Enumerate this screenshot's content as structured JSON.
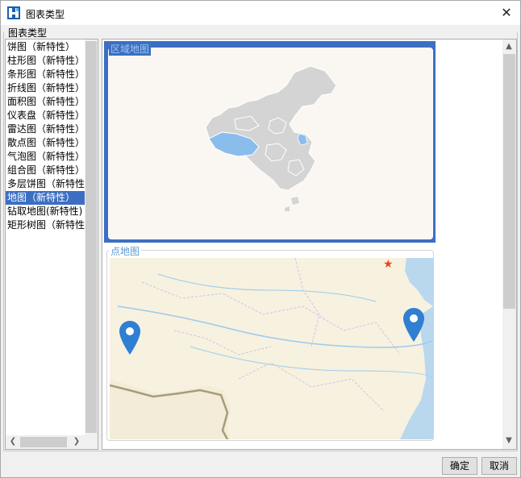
{
  "window": {
    "title": "图表类型"
  },
  "group": {
    "label": "图表类型"
  },
  "list": {
    "items": [
      {
        "label": "饼图（新特性）"
      },
      {
        "label": "柱形图（新特性）"
      },
      {
        "label": "条形图（新特性）"
      },
      {
        "label": "折线图（新特性）"
      },
      {
        "label": "面积图（新特性）"
      },
      {
        "label": "仪表盘（新特性）"
      },
      {
        "label": "雷达图（新特性）"
      },
      {
        "label": "散点图（新特性）"
      },
      {
        "label": "气泡图（新特性）"
      },
      {
        "label": "组合图（新特性）"
      },
      {
        "label": "多层饼图（新特性"
      },
      {
        "label": "地图（新特性）"
      },
      {
        "label": "钻取地图(新特性)"
      },
      {
        "label": "矩形树图（新特性"
      }
    ],
    "selected": "地图（新特性）"
  },
  "previews": {
    "region_map": {
      "label": "区域地图"
    },
    "point_map": {
      "label": "点地图"
    }
  },
  "buttons": {
    "ok": "确定",
    "cancel": "取消"
  },
  "colors": {
    "selection": "#3c6fc3",
    "accent_label": "#5b9bd5",
    "marker": "#2f7fd3",
    "star": "#e8471f"
  },
  "icons": {
    "app": "fine-report-icon",
    "close": "close-icon",
    "marker": "map-pin-icon"
  }
}
